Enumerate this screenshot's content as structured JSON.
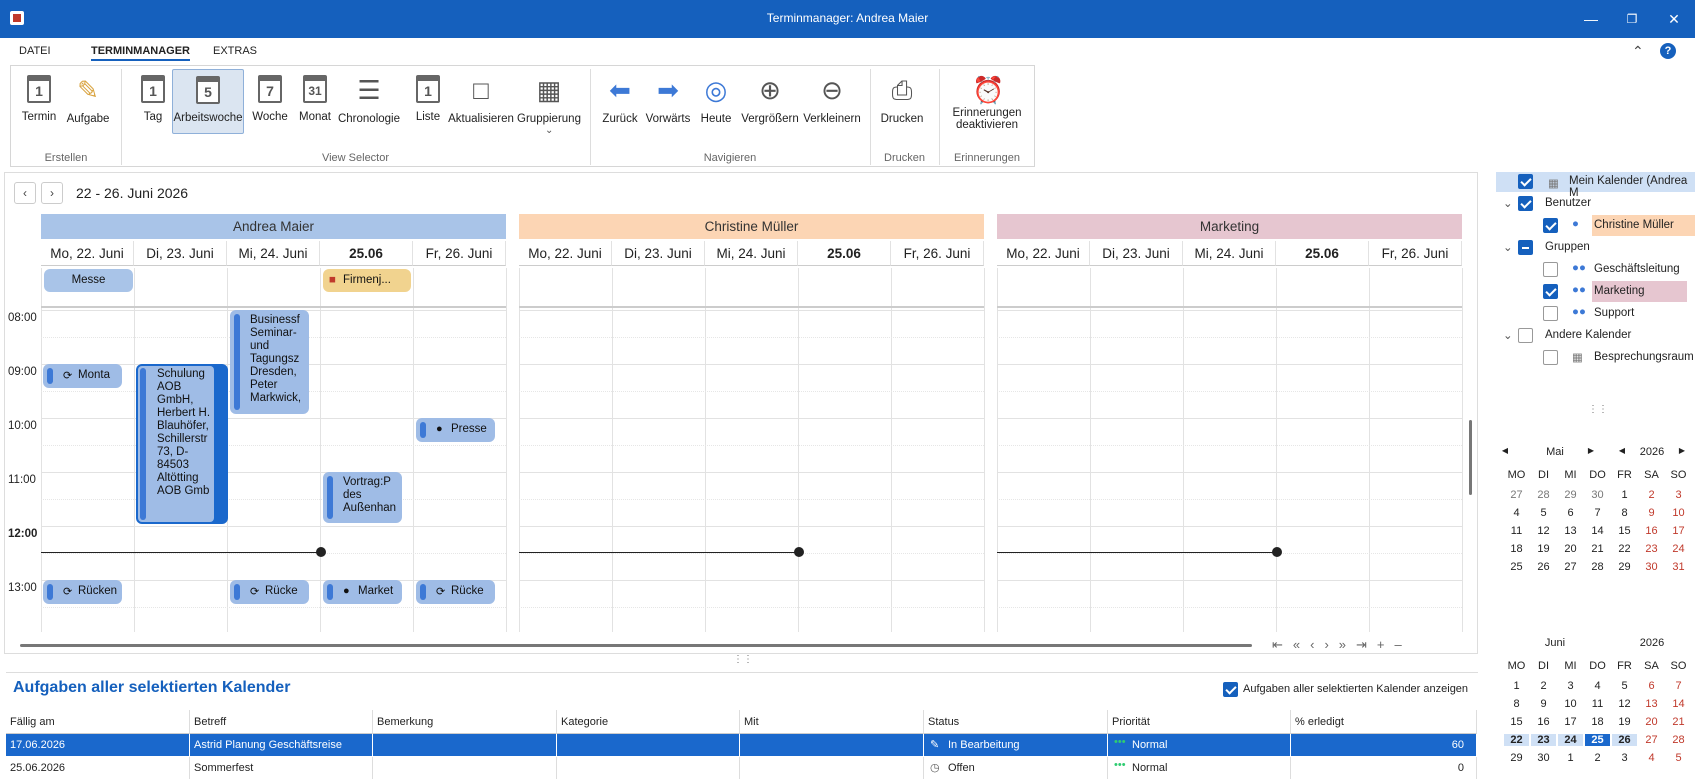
{
  "window": {
    "title": "Terminmanager: Andrea Maier"
  },
  "menu": {
    "file": "DATEI",
    "main": "TERMINMANAGER",
    "extras": "EXTRAS"
  },
  "ribbon": {
    "termin": "Termin",
    "aufgabe": "Aufgabe",
    "tag": "Tag",
    "arbeitswoche": "Arbeitswoche",
    "woche": "Woche",
    "monat": "Monat",
    "chronologie": "Chronologie",
    "liste": "Liste",
    "aktualisieren": "Aktualisieren",
    "gruppierung": "Gruppierung",
    "zurueck": "Zurück",
    "vorwaerts": "Vorwärts",
    "heute": "Heute",
    "vergroessern": "Vergrößern",
    "verkleinern": "Verkleinern",
    "drucken": "Drucken",
    "erinnerungen": "Erinnerungen",
    "erinnerungen2": "deaktivieren",
    "icon_tag": "1",
    "icon_aw": "5",
    "icon_woche": "7",
    "icon_monat": "31",
    "icon_liste": "1",
    "icon_termin": "1",
    "groups": {
      "erstellen": "Erstellen",
      "view": "View Selector",
      "navigieren": "Navigieren",
      "drucken": "Drucken",
      "erinnerungen": "Erinnerungen"
    }
  },
  "scheduler": {
    "range": "22 - 26. Juni 2026",
    "resources": [
      "Andrea Maier",
      "Christine Müller",
      "Marketing"
    ],
    "days": [
      "Mo, 22. Juni",
      "Di, 23. Juni",
      "Mi, 24. Juni",
      "25.06",
      "Fr, 26. Juni"
    ],
    "times": [
      "08:00",
      "09:00",
      "10:00",
      "11:00",
      "12:00",
      "13:00"
    ],
    "allday": {
      "messe": "Messe",
      "firmen": "Firmenj..."
    },
    "appts": {
      "monta": "Monta",
      "schulung": "Schulung AOB GmbH, Herbert H. Blauhöfer, Schillerstr 73, D-84503 Altötting AOB Gmb",
      "business": "Businessf Seminar- und Tagungsz Dresden, Peter Markwick,",
      "presse": "Presse",
      "vortrag": "Vortrag:P des Außenhan",
      "ruecken": "Rücken",
      "ruecke1": "Rücke",
      "market": "Market",
      "ruecke2": "Rücke"
    },
    "colors": {
      "andrea": "#a9c4e8",
      "christine": "#fcd5b4",
      "marketing": "#e6c6d0"
    }
  },
  "calendars": {
    "mein": "Mein Kalender (Andrea M",
    "benutzer": "Benutzer",
    "christine": "Christine Müller",
    "gruppen": "Gruppen",
    "gf": "Geschäftsleitung",
    "marketing": "Marketing",
    "support": "Support",
    "andere": "Andere Kalender",
    "raum": "Besprechungsraum"
  },
  "minical": {
    "may": {
      "month": "Mai",
      "year": "2026"
    },
    "june": {
      "month": "Juni",
      "year": "2026"
    },
    "dow": [
      "MO",
      "DI",
      "MI",
      "DO",
      "FR",
      "SA",
      "SO"
    ],
    "may_rows": [
      [
        "27",
        "28",
        "29",
        "30",
        "1",
        "2",
        "3"
      ],
      [
        "4",
        "5",
        "6",
        "7",
        "8",
        "9",
        "10"
      ],
      [
        "11",
        "12",
        "13",
        "14",
        "15",
        "16",
        "17"
      ],
      [
        "18",
        "19",
        "20",
        "21",
        "22",
        "23",
        "24"
      ],
      [
        "25",
        "26",
        "27",
        "28",
        "29",
        "30",
        "31"
      ]
    ],
    "june_rows": [
      [
        "1",
        "2",
        "3",
        "4",
        "5",
        "6",
        "7"
      ],
      [
        "8",
        "9",
        "10",
        "11",
        "12",
        "13",
        "14"
      ],
      [
        "15",
        "16",
        "17",
        "18",
        "19",
        "20",
        "21"
      ],
      [
        "22",
        "23",
        "24",
        "25",
        "26",
        "27",
        "28"
      ],
      [
        "29",
        "30",
        "1",
        "2",
        "3",
        "4",
        "5"
      ]
    ]
  },
  "tasks": {
    "title": "Aufgaben aller selektierten Kalender",
    "show_label": "Aufgaben aller selektierten Kalender anzeigen",
    "cols": [
      "Fällig am",
      "Betreff",
      "Bemerkung",
      "Kategorie",
      "Mit",
      "Status",
      "Priorität",
      "% erledigt"
    ],
    "rows": [
      {
        "due": "17.06.2026",
        "subject": "Astrid Planung Geschäftsreise",
        "status": "In Bearbeitung",
        "prio": "Normal",
        "pct": "60"
      },
      {
        "due": "25.06.2026",
        "subject": "Sommerfest",
        "status": "Offen",
        "prio": "Normal",
        "pct": "0"
      }
    ]
  }
}
